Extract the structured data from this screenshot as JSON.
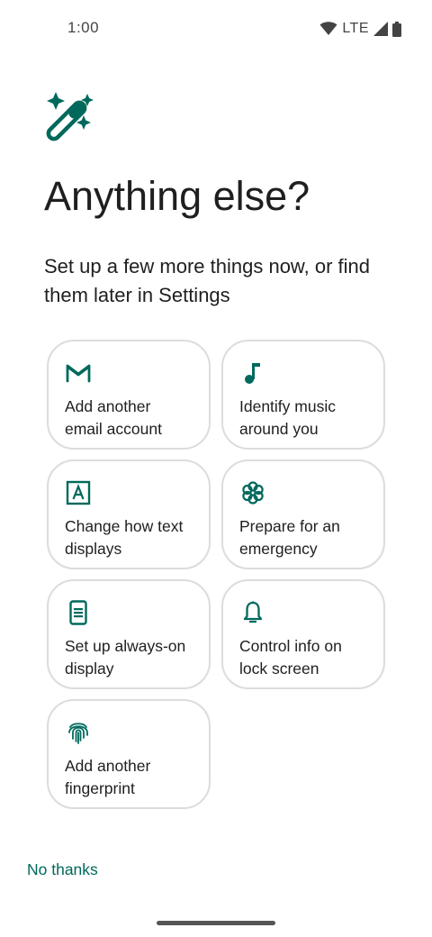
{
  "status_bar": {
    "time": "1:00",
    "network": "LTE"
  },
  "colors": {
    "accent": "#00695c",
    "card_border": "#dcdcdc",
    "text": "#1f1f1f"
  },
  "header": {
    "icon": "magic-wand-icon",
    "title": "Anything else?",
    "subtitle": "Set up a few more things now, or find them later in Settings"
  },
  "cards": [
    {
      "icon": "gmail-icon",
      "label": "Add another email account"
    },
    {
      "icon": "music-note-icon",
      "label": "Identify music around you"
    },
    {
      "icon": "text-display-icon",
      "label": "Change how text displays"
    },
    {
      "icon": "emergency-icon",
      "label": "Prepare for an emergency"
    },
    {
      "icon": "always-on-display-icon",
      "label": "Set up always-on display"
    },
    {
      "icon": "bell-icon",
      "label": "Control info on lock screen"
    },
    {
      "icon": "fingerprint-icon",
      "label": "Add another fingerprint"
    }
  ],
  "footer": {
    "no_thanks_label": "No thanks"
  }
}
